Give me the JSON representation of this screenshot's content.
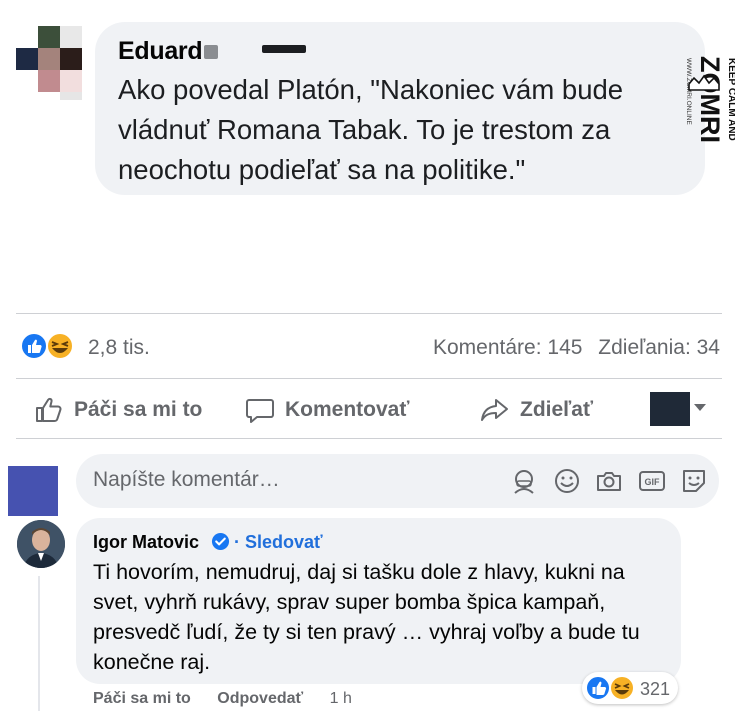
{
  "post_comment": {
    "author": "Eduard",
    "text": "Ako povedal Platón, \"Nakoniec vám bude vládnuť Romana Tabak. To je trestom za neochotu podieľať sa na politike.\"",
    "watermark_icon": "keep-calm-crown-logo",
    "watermark_top": "KEEP CALM AND",
    "watermark_word": "ZOMRI",
    "watermark_url": "WWW.ZOMRI.ONLINE"
  },
  "stats": {
    "reactions_count": "2,8 tis.",
    "comments": "Komentáre: 145",
    "shares": "Zdieľania: 34",
    "reaction_icons": [
      "like-icon",
      "haha-icon"
    ]
  },
  "actions": {
    "like": "Páči sa mi to",
    "comment": "Komentovať",
    "share": "Zdieľať"
  },
  "composer": {
    "placeholder": "Napíšte komentár…",
    "icons": [
      "avatar-sticker-icon",
      "emoji-icon",
      "camera-icon",
      "gif-icon",
      "sticker-icon"
    ]
  },
  "reply": {
    "author": "Igor Matovic",
    "follow": "· Sledovať",
    "text": "Ti hovorím, nemudruj, daj si tašku dole z hlavy, kukni na svet, vyhrň rukávy, sprav super bomba špica kampaň, presvedč ľudí, že ty si ten pravý … vyhraj voľby a bude tu konečne raj.",
    "reactions_count": "321",
    "like_action": "Páči sa mi to",
    "reply_action": "Odpovedať",
    "time": "1 h"
  },
  "colors": {
    "bubble": "#f0f2f5",
    "secondary_text": "#65676b",
    "link_blue": "#216fdb",
    "like_blue": "#1877f2",
    "haha_yellow": "#f7b125"
  }
}
